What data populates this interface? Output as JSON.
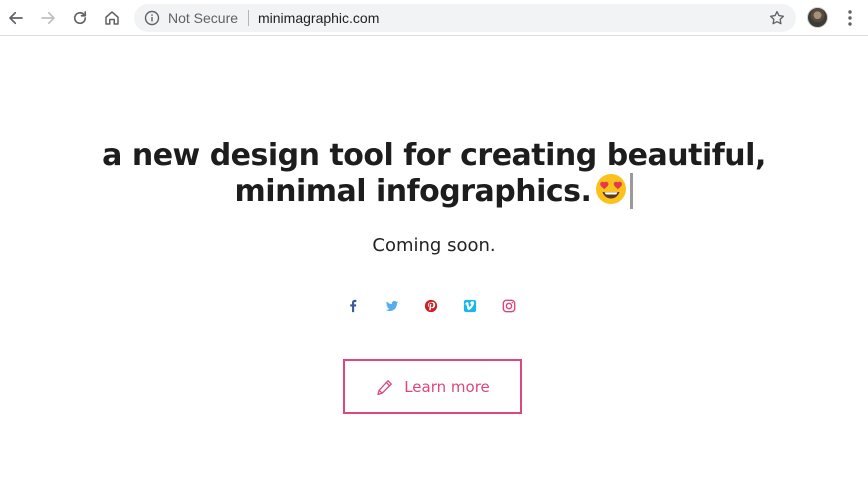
{
  "browser": {
    "security_label": "Not Secure",
    "url": "minimagraphic.com",
    "icons": {
      "back": "arrow-left-icon",
      "forward": "arrow-right-icon",
      "reload": "reload-icon",
      "home": "home-icon",
      "info": "info-icon",
      "bookmark": "star-icon",
      "menu": "kebab-menu-icon"
    }
  },
  "page": {
    "headline_line1": "a new design tool for creating beautiful,",
    "headline_line2": "minimal infographics.",
    "headline_emoji": "smiling-face-with-heart-eyes",
    "subtitle": "Coming soon.",
    "social": [
      {
        "name": "facebook",
        "color": "#3b5998"
      },
      {
        "name": "twitter",
        "color": "#55acee"
      },
      {
        "name": "pinterest",
        "color": "#cb2027"
      },
      {
        "name": "vimeo",
        "color": "#1ab7ea"
      },
      {
        "name": "instagram",
        "color": "#e0457b"
      }
    ],
    "cta": {
      "label": "Learn more",
      "icon": "pencil-icon",
      "color": "#e0457b"
    }
  }
}
